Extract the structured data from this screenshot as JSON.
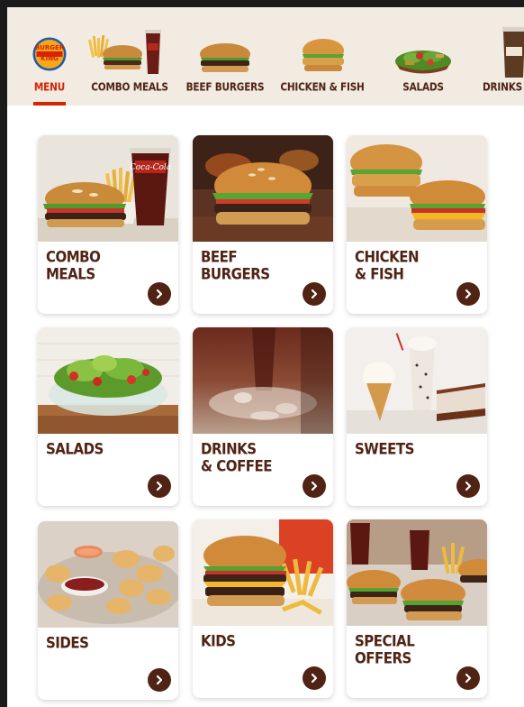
{
  "brand": {
    "logo_text_top": "BURGER",
    "logo_text_bottom": "KING"
  },
  "nav": {
    "items": [
      {
        "label": "MENU",
        "active": true
      },
      {
        "label": "COMBO MEALS",
        "active": false
      },
      {
        "label": "BEEF BURGERS",
        "active": false
      },
      {
        "label": "CHICKEN & FISH",
        "active": false
      },
      {
        "label": "SALADS",
        "active": false
      },
      {
        "label": "DRINKS &",
        "active": false
      }
    ]
  },
  "cards": [
    {
      "title_line1": "COMBO",
      "title_line2": "MEALS"
    },
    {
      "title_line1": "BEEF",
      "title_line2": "BURGERS"
    },
    {
      "title_line1": "CHICKEN",
      "title_line2": "& FISH"
    },
    {
      "title_line1": "SALADS",
      "title_line2": ""
    },
    {
      "title_line1": "DRINKS",
      "title_line2": "& COFFEE"
    },
    {
      "title_line1": "SWEETS",
      "title_line2": ""
    },
    {
      "title_line1": "SIDES",
      "title_line2": ""
    },
    {
      "title_line1": "KIDS",
      "title_line2": ""
    },
    {
      "title_line1": "SPECIAL",
      "title_line2": "OFFERS"
    }
  ],
  "photo_text": {
    "cola_brand": "Coca-Cola"
  },
  "colors": {
    "brand_brown": "#502314",
    "brand_red": "#d62300",
    "nav_bg": "#f1ebe2",
    "arrow_bg": "#502314"
  },
  "icons": {
    "card_arrow": "chevron-right-icon",
    "logo": "burger-king-logo"
  }
}
